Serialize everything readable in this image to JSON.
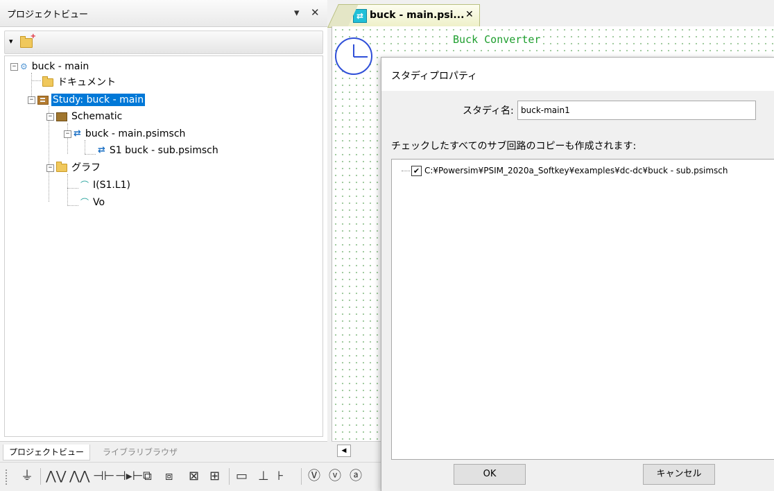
{
  "project_panel": {
    "title": "プロジェクトビュー",
    "dropdown_icon": "▾",
    "close_icon": "✕",
    "tree": [
      {
        "label": "buck - main",
        "icon": "project-icon"
      },
      {
        "label": "ドキュメント",
        "icon": "folder-icon"
      },
      {
        "label": "Study: buck - main",
        "icon": "study-icon",
        "selected": true
      },
      {
        "label": "Schematic",
        "icon": "schematic-icon"
      },
      {
        "label": "buck - main.psimsch",
        "icon": "subcircuit-icon"
      },
      {
        "label": "S1   buck - sub.psimsch",
        "icon": "subcircuit-icon"
      },
      {
        "label": "グラフ",
        "icon": "folder-icon"
      },
      {
        "label": "I(S1.L1)",
        "icon": "graph-icon"
      },
      {
        "label": "Vo",
        "icon": "graph-icon"
      }
    ],
    "tabs": [
      {
        "label": "プロジェクトビュー",
        "active": true
      },
      {
        "label": "ライブラリブラウザ",
        "active": false
      }
    ]
  },
  "component_toolbar": [
    "⏚",
    "⋀⋁",
    "⋀⋀",
    "⊣⊢",
    "⊣▸⊢",
    "⧉",
    "⧈",
    "⊠",
    "⊞",
    "▭",
    "⊥",
    "⊦",
    "Ⓥ",
    "ⓥ",
    "ⓐ"
  ],
  "editor": {
    "tab_label": "buck - main.psi...",
    "tab_close": "✕",
    "canvas_title": "Buck Converter",
    "scroll_left": "◀"
  },
  "dialog": {
    "title": "スタディプロパティ",
    "study_name_label": "スタディ名:",
    "study_name_value": "buck-main1",
    "copy_message": "チェックしたすべてのサブ回路のコピーも作成されます:",
    "subcircuits": [
      {
        "path": "C:¥Powersim¥PSIM_2020a_Softkey¥examples¥dc-dc¥buck - sub.psimsch",
        "checked": true
      }
    ],
    "check_mark": "✔",
    "ok_label": "OK",
    "cancel_label": "キャンセル"
  }
}
